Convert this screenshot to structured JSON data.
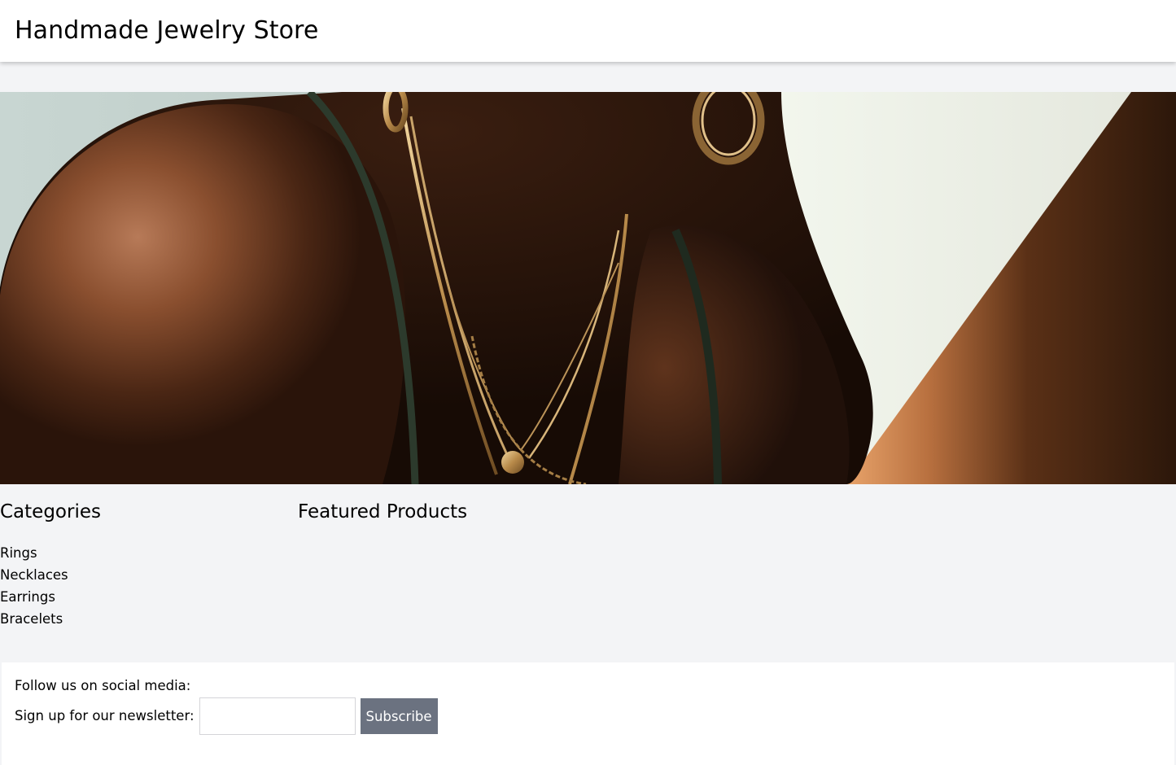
{
  "header": {
    "title": "Handmade Jewelry Store"
  },
  "hero": {
    "alt": "Woman wearing layered gold necklaces and hoop earrings"
  },
  "sidebar": {
    "heading": "Categories",
    "items": [
      {
        "label": "Rings"
      },
      {
        "label": "Necklaces"
      },
      {
        "label": "Earrings"
      },
      {
        "label": "Bracelets"
      }
    ]
  },
  "main": {
    "heading": "Featured Products"
  },
  "footer": {
    "social_text": "Follow us on social media:",
    "newsletter_label": "Sign up for our newsletter:",
    "email_value": "",
    "email_placeholder": "",
    "subscribe_label": "Subscribe"
  },
  "colors": {
    "page_bg": "#f3f4f6",
    "header_bg": "#ffffff",
    "footer_bg": "#ffffff",
    "button_bg": "#6b7280",
    "button_text": "#ffffff"
  }
}
